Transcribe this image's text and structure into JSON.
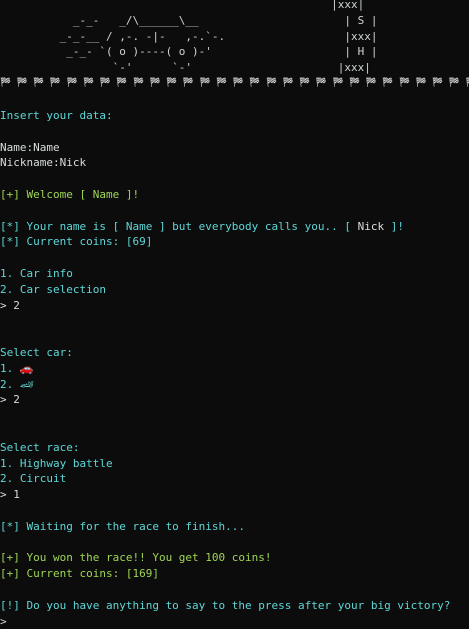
{
  "banner": {
    "art_lines": [
      "                                                  |xxx|",
      "           _-_-   _/\\______\\__                      | S |",
      "         _-_-__ / ,-. -|-   ,-.`-.                  |xxx|",
      "          _-_- `( o )----( o )-'                    | H |",
      "                 `-'      `-'                      |xxx|"
    ],
    "separator": "🏁 🏁 🏁 🏁 🏁 🏁 🏁 🏁 🏁 🏁 🏁 🏁 🏁 🏁 🏁 🏁 🏁 🏁 🏁 🏁 🏁 🏁 🏁 🏁 🏁 🏁 🏁 🏁 🏁 🏁 🏁 🏁 🏁"
  },
  "lines": {
    "insert": "Insert your data:",
    "name": "Name:Name",
    "nickname": "Nickname:Nick",
    "welcome": "[+] Welcome [ Name ]!",
    "name_is_prefix": "[*] Your name is [ Name ] but everybody calls you.. [",
    "nick": " Nick ",
    "name_is_suffix": "]!",
    "coins_1": "[*] Current coins: [69]",
    "menu_1": "1. Car info",
    "menu_2": "2. Car selection",
    "prompt_1": "> 2",
    "select_car": "Select car:",
    "car_1": "1. 🚗",
    "car_2": "2. 🏎",
    "prompt_2": "> 2",
    "select_race": "Select race:",
    "race_1": "1. Highway battle",
    "race_2": "2. Circuit",
    "prompt_3": "> 1",
    "waiting": "[*] Waiting for the race to finish...",
    "won": "[+] You won the race!! You get 100 coins!",
    "coins_2": "[+] Current coins: [169]",
    "press": "[!] Do you have anything to say to the press after your big victory?",
    "prompt_final": ">"
  },
  "colors": {
    "background": "#0c0c0c",
    "cyan": "#5fd7d7",
    "green": "#9fd656",
    "text": "#cfd6d3"
  }
}
